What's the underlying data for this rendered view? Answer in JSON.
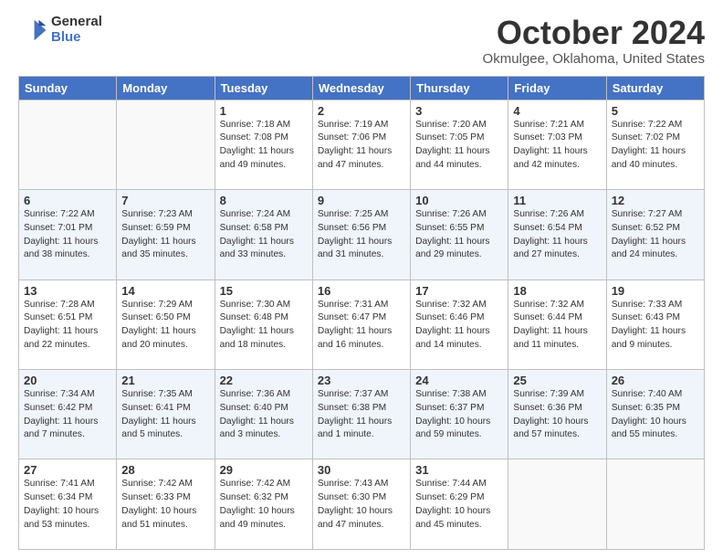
{
  "header": {
    "logo_line1": "General",
    "logo_line2": "Blue",
    "month_title": "October 2024",
    "location": "Okmulgee, Oklahoma, United States"
  },
  "days_of_week": [
    "Sunday",
    "Monday",
    "Tuesday",
    "Wednesday",
    "Thursday",
    "Friday",
    "Saturday"
  ],
  "weeks": [
    [
      {
        "day": "",
        "text": ""
      },
      {
        "day": "",
        "text": ""
      },
      {
        "day": "1",
        "text": "Sunrise: 7:18 AM\nSunset: 7:08 PM\nDaylight: 11 hours\nand 49 minutes."
      },
      {
        "day": "2",
        "text": "Sunrise: 7:19 AM\nSunset: 7:06 PM\nDaylight: 11 hours\nand 47 minutes."
      },
      {
        "day": "3",
        "text": "Sunrise: 7:20 AM\nSunset: 7:05 PM\nDaylight: 11 hours\nand 44 minutes."
      },
      {
        "day": "4",
        "text": "Sunrise: 7:21 AM\nSunset: 7:03 PM\nDaylight: 11 hours\nand 42 minutes."
      },
      {
        "day": "5",
        "text": "Sunrise: 7:22 AM\nSunset: 7:02 PM\nDaylight: 11 hours\nand 40 minutes."
      }
    ],
    [
      {
        "day": "6",
        "text": "Sunrise: 7:22 AM\nSunset: 7:01 PM\nDaylight: 11 hours\nand 38 minutes."
      },
      {
        "day": "7",
        "text": "Sunrise: 7:23 AM\nSunset: 6:59 PM\nDaylight: 11 hours\nand 35 minutes."
      },
      {
        "day": "8",
        "text": "Sunrise: 7:24 AM\nSunset: 6:58 PM\nDaylight: 11 hours\nand 33 minutes."
      },
      {
        "day": "9",
        "text": "Sunrise: 7:25 AM\nSunset: 6:56 PM\nDaylight: 11 hours\nand 31 minutes."
      },
      {
        "day": "10",
        "text": "Sunrise: 7:26 AM\nSunset: 6:55 PM\nDaylight: 11 hours\nand 29 minutes."
      },
      {
        "day": "11",
        "text": "Sunrise: 7:26 AM\nSunset: 6:54 PM\nDaylight: 11 hours\nand 27 minutes."
      },
      {
        "day": "12",
        "text": "Sunrise: 7:27 AM\nSunset: 6:52 PM\nDaylight: 11 hours\nand 24 minutes."
      }
    ],
    [
      {
        "day": "13",
        "text": "Sunrise: 7:28 AM\nSunset: 6:51 PM\nDaylight: 11 hours\nand 22 minutes."
      },
      {
        "day": "14",
        "text": "Sunrise: 7:29 AM\nSunset: 6:50 PM\nDaylight: 11 hours\nand 20 minutes."
      },
      {
        "day": "15",
        "text": "Sunrise: 7:30 AM\nSunset: 6:48 PM\nDaylight: 11 hours\nand 18 minutes."
      },
      {
        "day": "16",
        "text": "Sunrise: 7:31 AM\nSunset: 6:47 PM\nDaylight: 11 hours\nand 16 minutes."
      },
      {
        "day": "17",
        "text": "Sunrise: 7:32 AM\nSunset: 6:46 PM\nDaylight: 11 hours\nand 14 minutes."
      },
      {
        "day": "18",
        "text": "Sunrise: 7:32 AM\nSunset: 6:44 PM\nDaylight: 11 hours\nand 11 minutes."
      },
      {
        "day": "19",
        "text": "Sunrise: 7:33 AM\nSunset: 6:43 PM\nDaylight: 11 hours\nand 9 minutes."
      }
    ],
    [
      {
        "day": "20",
        "text": "Sunrise: 7:34 AM\nSunset: 6:42 PM\nDaylight: 11 hours\nand 7 minutes."
      },
      {
        "day": "21",
        "text": "Sunrise: 7:35 AM\nSunset: 6:41 PM\nDaylight: 11 hours\nand 5 minutes."
      },
      {
        "day": "22",
        "text": "Sunrise: 7:36 AM\nSunset: 6:40 PM\nDaylight: 11 hours\nand 3 minutes."
      },
      {
        "day": "23",
        "text": "Sunrise: 7:37 AM\nSunset: 6:38 PM\nDaylight: 11 hours\nand 1 minute."
      },
      {
        "day": "24",
        "text": "Sunrise: 7:38 AM\nSunset: 6:37 PM\nDaylight: 10 hours\nand 59 minutes."
      },
      {
        "day": "25",
        "text": "Sunrise: 7:39 AM\nSunset: 6:36 PM\nDaylight: 10 hours\nand 57 minutes."
      },
      {
        "day": "26",
        "text": "Sunrise: 7:40 AM\nSunset: 6:35 PM\nDaylight: 10 hours\nand 55 minutes."
      }
    ],
    [
      {
        "day": "27",
        "text": "Sunrise: 7:41 AM\nSunset: 6:34 PM\nDaylight: 10 hours\nand 53 minutes."
      },
      {
        "day": "28",
        "text": "Sunrise: 7:42 AM\nSunset: 6:33 PM\nDaylight: 10 hours\nand 51 minutes."
      },
      {
        "day": "29",
        "text": "Sunrise: 7:42 AM\nSunset: 6:32 PM\nDaylight: 10 hours\nand 49 minutes."
      },
      {
        "day": "30",
        "text": "Sunrise: 7:43 AM\nSunset: 6:30 PM\nDaylight: 10 hours\nand 47 minutes."
      },
      {
        "day": "31",
        "text": "Sunrise: 7:44 AM\nSunset: 6:29 PM\nDaylight: 10 hours\nand 45 minutes."
      },
      {
        "day": "",
        "text": ""
      },
      {
        "day": "",
        "text": ""
      }
    ]
  ]
}
